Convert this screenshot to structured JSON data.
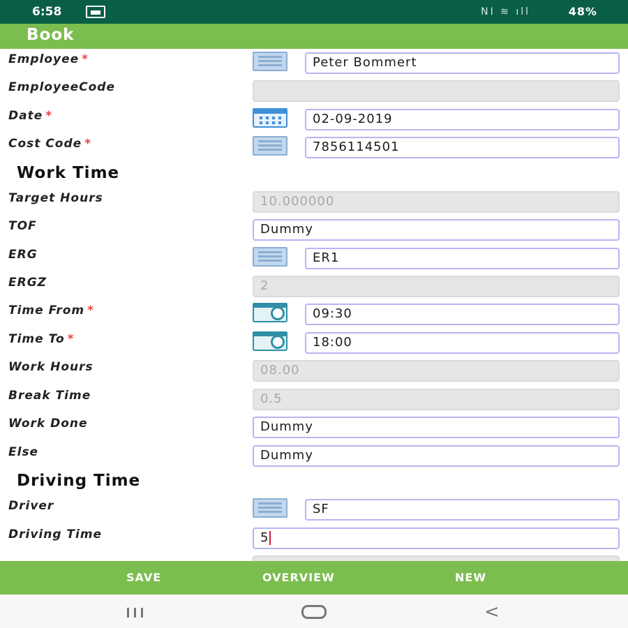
{
  "status_bar": {
    "time": "6:58",
    "battery": "48%",
    "icons": [
      "notification-icon",
      "nfc-icon",
      "wifi-icon",
      "signal-icon",
      "battery-icon"
    ]
  },
  "app_bar": {
    "title": "Book"
  },
  "form": {
    "employee": {
      "label": "Employee",
      "required": "*",
      "value": "Peter Bommert"
    },
    "employee_code": {
      "label": "EmployeeCode",
      "value": ""
    },
    "date": {
      "label": "Date",
      "required": "*",
      "value": "02-09-2019"
    },
    "cost_code": {
      "label": "Cost Code",
      "required": "*",
      "value": "7856114501"
    },
    "work_time_header": "Work Time",
    "target_hours": {
      "label": "Target Hours",
      "value": "10.000000"
    },
    "tof": {
      "label": "TOF",
      "value": "Dummy"
    },
    "erg": {
      "label": "ERG",
      "value": "ER1"
    },
    "ergz": {
      "label": "ERGZ",
      "value": "2"
    },
    "time_from": {
      "label": "Time From",
      "required": "*",
      "value": "09:30"
    },
    "time_to": {
      "label": "Time To",
      "required": "*",
      "value": "18:00"
    },
    "work_hours": {
      "label": "Work Hours",
      "value": "08.00"
    },
    "break_time": {
      "label": "Break Time",
      "value": "0.5"
    },
    "work_done": {
      "label": "Work Done",
      "value": "Dummy"
    },
    "else": {
      "label": "Else",
      "value": "Dummy"
    },
    "driving_time_header": "Driving Time",
    "driver": {
      "label": "Driver",
      "value": "SF"
    },
    "driving_time": {
      "label": "Driving Time",
      "value": "5"
    }
  },
  "actions": {
    "save": "SAVE",
    "overview": "OVERVIEW",
    "new": "NEW"
  },
  "colors": {
    "status_bar": "#0a5e46",
    "app_bar": "#7cbd4f",
    "required": "#e04848",
    "field_border": "#b8b4f2",
    "disabled_field": "#e6e6e6"
  }
}
